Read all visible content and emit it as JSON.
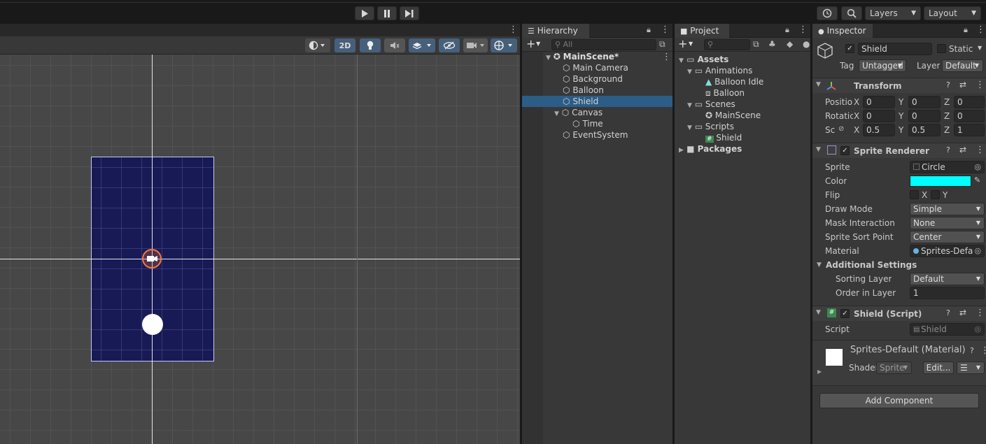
{
  "toolbar": {
    "history_icon": "history-icon",
    "search_icon": "search-icon",
    "layers_label": "Layers",
    "layout_label": "Layout"
  },
  "scene": {
    "mode_2d_label": "2D"
  },
  "hierarchy": {
    "tab_label": "Hierarchy",
    "search_placeholder": "All",
    "scene_name": "MainScene*",
    "items": [
      {
        "label": "Main Camera"
      },
      {
        "label": "Background"
      },
      {
        "label": "Balloon"
      },
      {
        "label": "Shield",
        "selected": true
      },
      {
        "label": "Canvas"
      },
      {
        "label": "Time"
      },
      {
        "label": "EventSystem"
      }
    ]
  },
  "project": {
    "tab_label": "Project",
    "tree": [
      {
        "label": "Assets"
      },
      {
        "label": "Animations"
      },
      {
        "label": "Balloon Idle"
      },
      {
        "label": "Balloon"
      },
      {
        "label": "Scenes"
      },
      {
        "label": "MainScene"
      },
      {
        "label": "Scripts"
      },
      {
        "label": "Shield"
      },
      {
        "label": "Packages"
      }
    ]
  },
  "inspector": {
    "tab_label": "Inspector",
    "object_name": "Shield",
    "static_label": "Static",
    "tag_label": "Tag",
    "tag_value": "Untagged",
    "layer_label": "Layer",
    "layer_value": "Default",
    "transform": {
      "title": "Transform",
      "position_label": "Positio",
      "rotation_label": "Rotatic",
      "scale_label": "Sc",
      "position": {
        "x": "0",
        "y": "0",
        "z": "0"
      },
      "rotation": {
        "x": "0",
        "y": "0",
        "z": "0"
      },
      "scale": {
        "x": "0.5",
        "y": "0.5",
        "z": "1"
      },
      "axis_x": "X",
      "axis_y": "Y",
      "axis_z": "Z"
    },
    "sprite_renderer": {
      "title": "Sprite Renderer",
      "sprite_label": "Sprite",
      "sprite_value": "Circle",
      "color_label": "Color",
      "color_value": "#00ffff",
      "flip_label": "Flip",
      "flip_x": "X",
      "flip_y": "Y",
      "draw_mode_label": "Draw Mode",
      "draw_mode_value": "Simple",
      "mask_label": "Mask Interaction",
      "mask_value": "None",
      "sort_point_label": "Sprite Sort Point",
      "sort_point_value": "Center",
      "material_label": "Material",
      "material_value": "Sprites-Defa",
      "additional_label": "Additional Settings",
      "sorting_layer_label": "Sorting Layer",
      "sorting_layer_value": "Default",
      "order_label": "Order in Layer",
      "order_value": "1"
    },
    "script_comp": {
      "title": "Shield (Script)",
      "script_label": "Script",
      "script_value": "Shield"
    },
    "material": {
      "title": "Sprites-Default (Material)",
      "shader_label": "Shader",
      "shader_value": "Sprite",
      "edit_label": "Edit..."
    },
    "add_component_label": "Add Component"
  }
}
